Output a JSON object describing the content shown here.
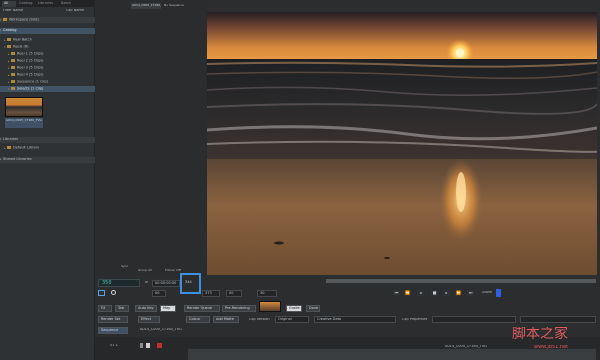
{
  "left": {
    "tabs": [
      "All",
      "Catalog",
      "Libraries",
      "Batch"
    ],
    "filter": "Filter Name",
    "sort": "Clip Name",
    "rows": [
      "Workspace (Slot)",
      "Catalog",
      "New Batch",
      "Reels (6)",
      "Reel 1 (5 Clips)",
      "Reel 2 (5 Clips)",
      "Reel 3 (5 Clips)",
      "Reel 4 (5 Clips)",
      "Sequence (1 Clip)",
      "Selects (1 Clip)"
    ],
    "thumb_label": "A014_C005_17160_TVG",
    "libraries_header": "Libraries",
    "library_item": "Default Library",
    "shared_libraries": "Shared Libraries"
  },
  "top": {
    "tab": "A014_C005_17160_TVG",
    "no_sequence": "No Sequence"
  },
  "controls": {
    "frame": "350",
    "in_label": "In",
    "timecode": "00:00:00:00",
    "box_value": "344",
    "field2": "00",
    "field3": "373",
    "field4": "00",
    "field5": "30",
    "play_labels": [
      "Sync",
      "Group All",
      "Follow: Off"
    ],
    "zoom_label": "Zoom"
  },
  "toolbar": {
    "buttons": [
      "FX",
      "Tab",
      "Auto Key",
      "Map",
      "Render Queue",
      "Pre-Rendering"
    ],
    "thumb_btn": "Grade",
    "last": "Done",
    "row2": [
      "Render Set",
      "Effect",
      "Colour",
      "Add Matte",
      "Clip Version",
      "Original",
      "Creative Data",
      "Clip Properties"
    ],
    "sequence_label": "Sequence",
    "clip_tab": "A014_C005_17160_TVG",
    "track_label": "V1 L",
    "bottom_clip": "A014_C005_17160_TVG"
  },
  "watermark": {
    "cn": "脚本之家",
    "url": "www.jb51.net"
  }
}
